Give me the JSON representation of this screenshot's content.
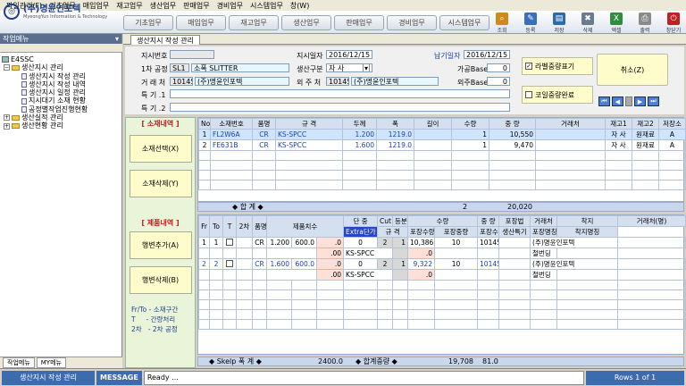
{
  "menubar": [
    "파일관리(F)",
    "기초업무",
    "매입업무",
    "재고업무",
    "생산업무",
    "판매업무",
    "경비업무",
    "시스템업무",
    "창(W)"
  ],
  "logo": {
    "text": "(주)명윤인포텍",
    "sub": "MyeongYun Information & Technology"
  },
  "topmenu": [
    "기초업무",
    "매입업무",
    "재고업무",
    "생산업무",
    "판매업무",
    "경비업무",
    "시스템업무"
  ],
  "tools": [
    {
      "label": "조회",
      "icon": "search-icon",
      "color": "#d08a1a"
    },
    {
      "label": "등록",
      "icon": "register-icon",
      "color": "#3a6fc0"
    },
    {
      "label": "저장",
      "icon": "save-icon",
      "color": "#2b6bb0"
    },
    {
      "label": "삭제",
      "icon": "delete-icon",
      "color": "#6a7a90"
    },
    {
      "label": "엑셀",
      "icon": "excel-icon",
      "color": "#2f8f3f"
    },
    {
      "label": "출력",
      "icon": "print-icon",
      "color": "#8a8a8a"
    },
    {
      "label": "창닫기",
      "icon": "power-icon",
      "color": "#c02020"
    }
  ],
  "sidebar": {
    "title": "작업메뉴",
    "pin": "뮤",
    "root": "E4SSC",
    "items": [
      {
        "label": "생산지시 관리",
        "type": "folder",
        "level": 1
      },
      {
        "label": "생산지시 작성 관리",
        "type": "doc",
        "level": 2
      },
      {
        "label": "생산지시 작성 내역",
        "type": "doc",
        "level": 2
      },
      {
        "label": "생산지시 일정 관리",
        "type": "doc",
        "level": 2
      },
      {
        "label": "지시대기 소재 현황",
        "type": "doc",
        "level": 2
      },
      {
        "label": "공정별작업진행현황",
        "type": "doc",
        "level": 2
      },
      {
        "label": "생산실적 관리",
        "type": "folder",
        "level": 1
      },
      {
        "label": "생산현황 관리",
        "type": "folder",
        "level": 1
      }
    ],
    "tabs": [
      "작업메뉴",
      "MY메뉴"
    ]
  },
  "tab": {
    "label": "생산지시 작성 관리"
  },
  "form": {
    "l_jisi": "지시번호",
    "v_jisi": "",
    "l_jisidate": "지시일자",
    "v_jisidate": "2016/12/15",
    "l_nabgi": "납기일자",
    "v_nabgi": "2016/12/15",
    "l_gongjeong": "1차 공정",
    "v_gj_code": "SL1",
    "v_gj_name": "소폭 SLITTER",
    "l_gubun": "생산구분",
    "v_gubun": "자 사",
    "l_gabase": "가공Base",
    "v_gabase": "0",
    "l_geo": "거 래 처",
    "v_geo_code": "10145",
    "v_geo_name": "(주)명윤인포텍",
    "l_oiju": "외 주 처",
    "v_oiju_code": "10145",
    "v_oiju_name": "(주)명윤인포텍",
    "l_oibase": "외주Base",
    "v_oibase": "0",
    "l_tg1": "특 기 .1",
    "l_tg2": "특 기 .2",
    "chk1": "라벨중량표기",
    "chk2": "코일중량완료",
    "cancel": "취소(Z)"
  },
  "left": {
    "sec1": "[ 소재내역 ]",
    "btn1": "소재선택(X)",
    "btn2": "소재삭제(Y)",
    "sec2": "[ 제품내역 ]",
    "btn3": "행변추가(A)",
    "btn4": "행변삭제(B)",
    "legend": [
      "Fr/To - 소재구간",
      "T     - 간량처리",
      "2차   - 2차 공정"
    ]
  },
  "top_grid": {
    "headers": [
      "No",
      "소재번호",
      "품명",
      "규 격",
      "두께",
      "폭",
      "길이",
      "수량",
      "중 량",
      "거래처",
      "재고1",
      "재고2",
      "저장소"
    ],
    "rows": [
      [
        "1",
        "FL2W6A",
        "CR",
        "KS-SPCC",
        "1.200",
        "1219.0",
        "",
        "1",
        "10,550",
        "",
        "자 사",
        "원재료",
        "A"
      ],
      [
        "2",
        "FE631B",
        "CR",
        "KS-SPCC",
        "1.600",
        "1219.0",
        "",
        "1",
        "9,470",
        "",
        "자 사",
        "원재료",
        "A"
      ]
    ],
    "sum_label": "◆ 합 계 ◆",
    "sum_qty": "2",
    "sum_wt": "20,020"
  },
  "bot_grid": {
    "h1": [
      "Fr",
      "To",
      "T",
      "2차",
      "품명",
      "제품치수",
      "단 중",
      "Cut",
      "등분",
      "수량",
      "중 량",
      "포장법",
      "거래처",
      "착지",
      "거래처(명)"
    ],
    "h2": [
      "Extra단가",
      "규 격",
      "포장수량",
      "포장중량",
      "포장수",
      "생산특기",
      "포장명칭",
      "착지명칭"
    ],
    "rows": [
      {
        "fr": "1",
        "to": "1",
        "pm": "CR",
        "d1": "1.200",
        "d2": "600.0",
        "dz": ".0",
        "cut": "0",
        "dv": "2",
        "qty": "1",
        "wt": "10,386",
        "pk": "10",
        "cust": "10145",
        "name": "(주)명윤인포텍",
        "ex": ".00",
        "spec": "KS-SPCC",
        "pkw": ".0",
        "pkn": "철번딩"
      },
      {
        "fr": "2",
        "to": "2",
        "pm": "CR",
        "d1": "1.600",
        "d2": "600.0",
        "dz": ".0",
        "cut": "0",
        "dv": "2",
        "qty": "1",
        "wt": "9,322",
        "pk": "10",
        "cust": "10145",
        "name": "(주)명윤인포텍",
        "ex": ".00",
        "spec": "KS-SPCC",
        "pkw": ".0",
        "pkn": "철번딩"
      }
    ],
    "sum_skelp": "◆ Skelp 폭 계 ◆",
    "skelp_val": "2400.0",
    "sum_label": "◆ 합계중량 ◆",
    "sum_wt": "19,708",
    "sum_x": "81.0"
  },
  "status": {
    "screen": "생산지시 작성 관리",
    "msg_label": "MESSAGE",
    "msg": "Ready ...",
    "rows": "Rows 1 of 1"
  }
}
